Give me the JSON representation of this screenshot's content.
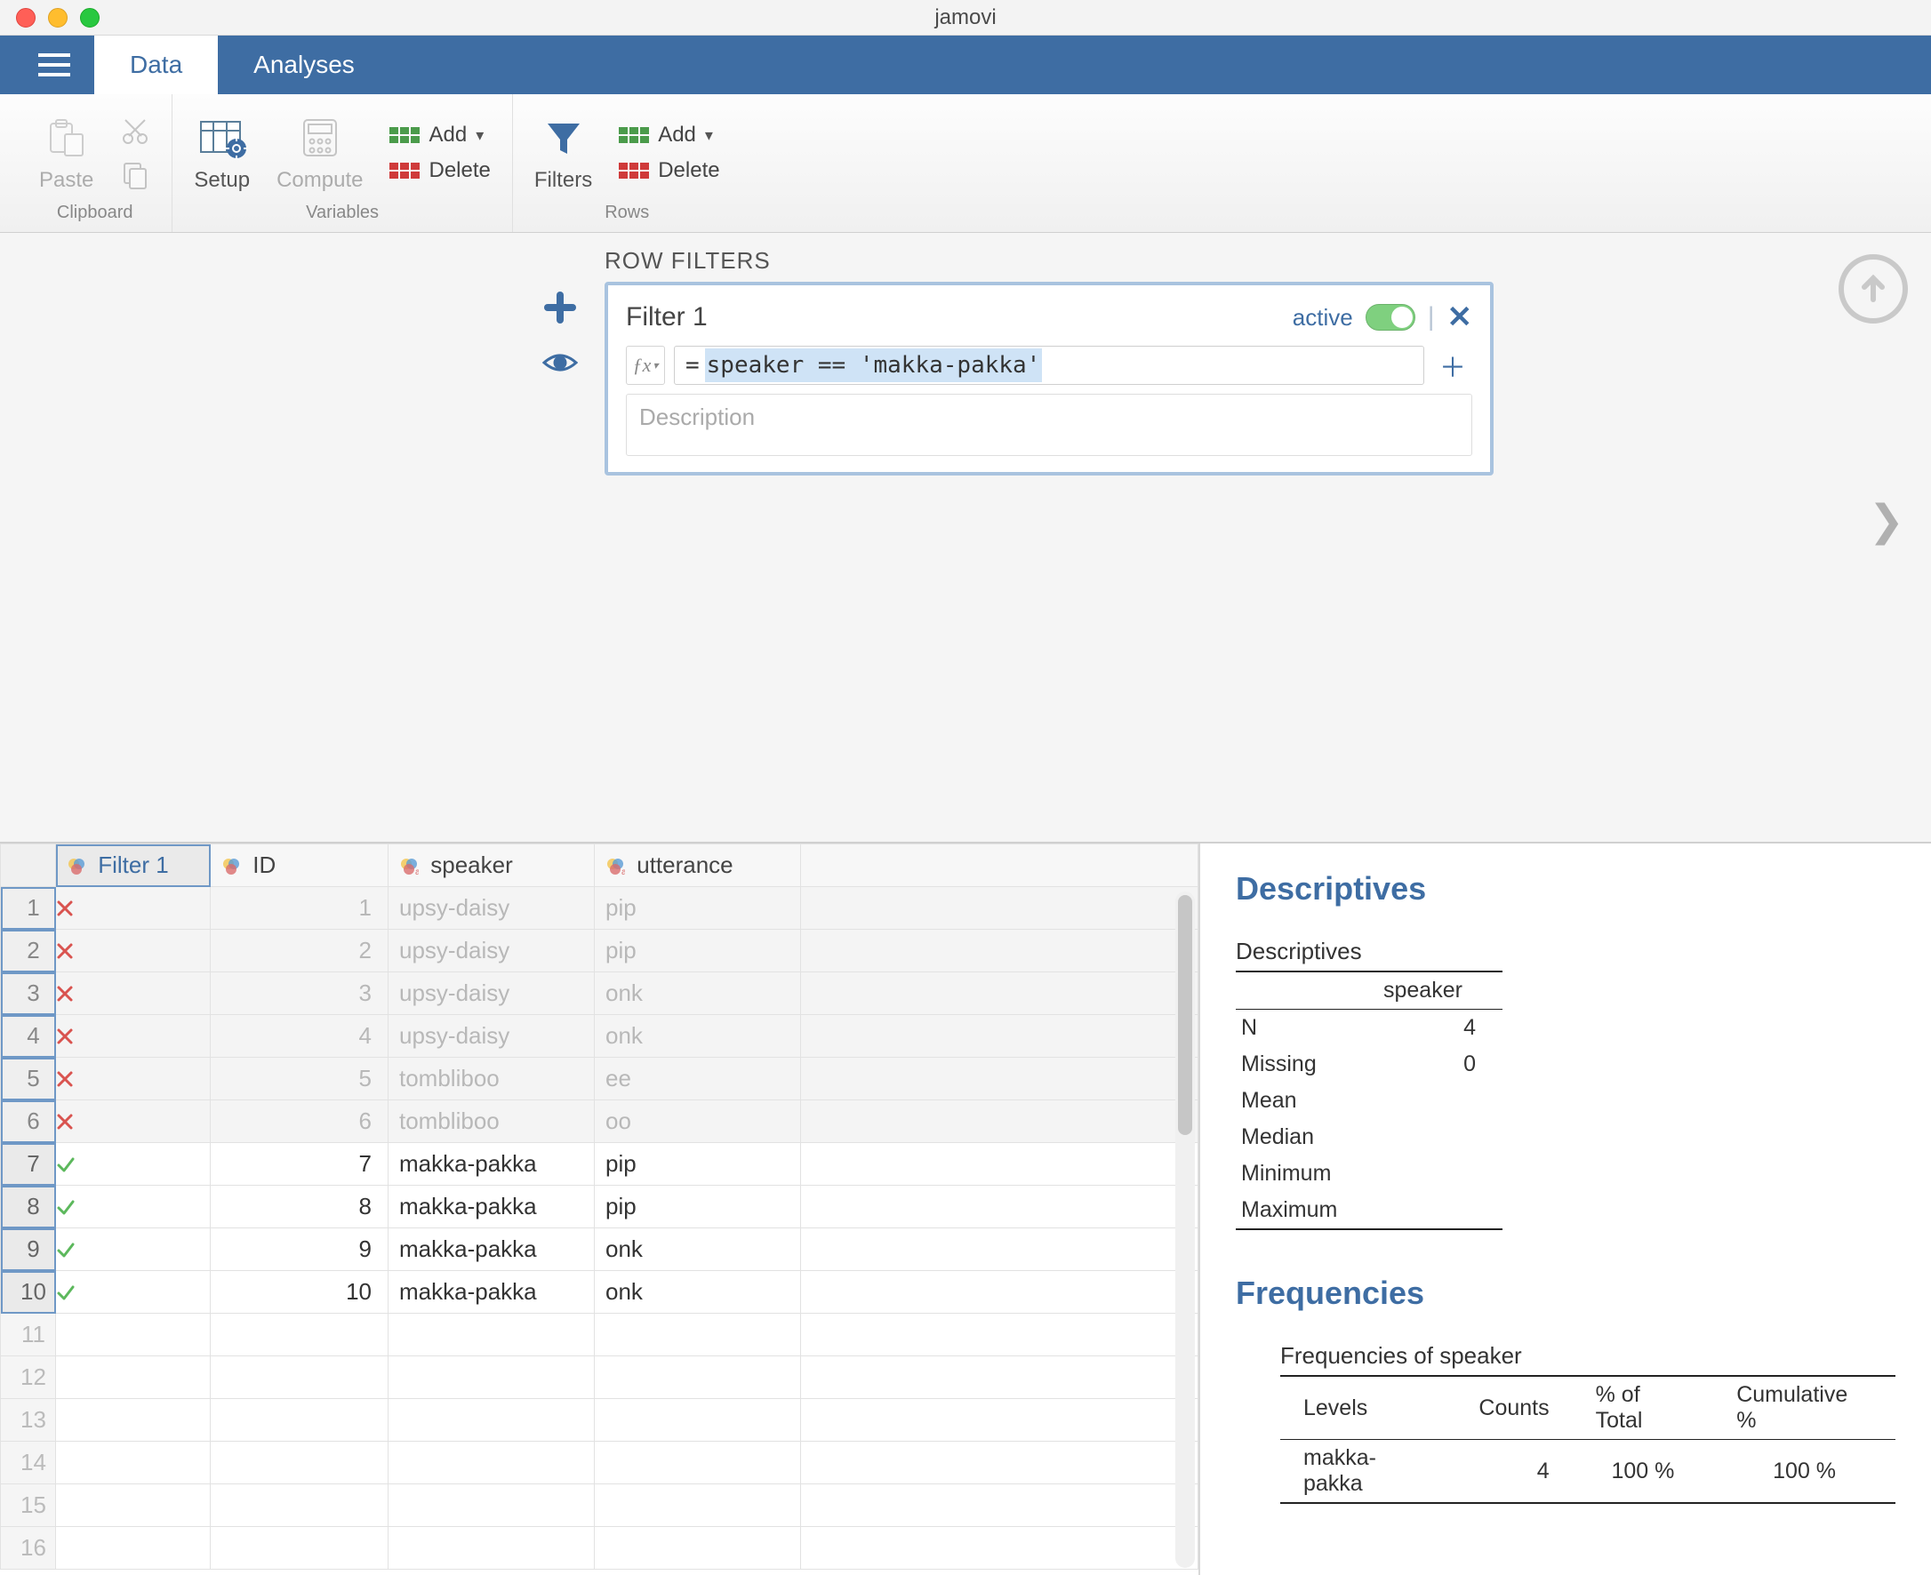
{
  "window": {
    "title": "jamovi"
  },
  "tabs": {
    "data": "Data",
    "analyses": "Analyses"
  },
  "ribbon": {
    "paste": "Paste",
    "clipboard": "Clipboard",
    "setup": "Setup",
    "compute": "Compute",
    "variables": "Variables",
    "var_add": "Add",
    "var_delete": "Delete",
    "filters": "Filters",
    "row_add": "Add",
    "row_delete": "Delete",
    "rows": "Rows"
  },
  "filter_panel": {
    "heading": "ROW FILTERS",
    "card_title": "Filter 1",
    "active_label": "active",
    "fx_label": "ƒx",
    "formula_eq": "=",
    "formula_expr": "speaker == 'makka-pakka'",
    "desc_placeholder": "Description"
  },
  "spreadsheet": {
    "columns": {
      "filter": "Filter 1",
      "id": "ID",
      "speaker": "speaker",
      "utterance": "utterance"
    },
    "rows": [
      {
        "n": 1,
        "pass": false,
        "id": 1,
        "speaker": "upsy-daisy",
        "utterance": "pip"
      },
      {
        "n": 2,
        "pass": false,
        "id": 2,
        "speaker": "upsy-daisy",
        "utterance": "pip"
      },
      {
        "n": 3,
        "pass": false,
        "id": 3,
        "speaker": "upsy-daisy",
        "utterance": "onk"
      },
      {
        "n": 4,
        "pass": false,
        "id": 4,
        "speaker": "upsy-daisy",
        "utterance": "onk"
      },
      {
        "n": 5,
        "pass": false,
        "id": 5,
        "speaker": "tombliboo",
        "utterance": "ee"
      },
      {
        "n": 6,
        "pass": false,
        "id": 6,
        "speaker": "tombliboo",
        "utterance": "oo"
      },
      {
        "n": 7,
        "pass": true,
        "id": 7,
        "speaker": "makka-pakka",
        "utterance": "pip"
      },
      {
        "n": 8,
        "pass": true,
        "id": 8,
        "speaker": "makka-pakka",
        "utterance": "pip"
      },
      {
        "n": 9,
        "pass": true,
        "id": 9,
        "speaker": "makka-pakka",
        "utterance": "onk"
      },
      {
        "n": 10,
        "pass": true,
        "id": 10,
        "speaker": "makka-pakka",
        "utterance": "onk"
      }
    ],
    "empty_rows": [
      11,
      12,
      13,
      14,
      15,
      16
    ]
  },
  "results": {
    "descriptives_title": "Descriptives",
    "descriptives_sub": "Descriptives",
    "desc_col": "speaker",
    "desc_rows": [
      {
        "label": "N",
        "value": "4"
      },
      {
        "label": "Missing",
        "value": "0"
      },
      {
        "label": "Mean",
        "value": ""
      },
      {
        "label": "Median",
        "value": ""
      },
      {
        "label": "Minimum",
        "value": ""
      },
      {
        "label": "Maximum",
        "value": ""
      }
    ],
    "frequencies_title": "Frequencies",
    "freq_sub": "Frequencies of speaker",
    "freq_headers": {
      "levels": "Levels",
      "counts": "Counts",
      "pct": "% of Total",
      "cum": "Cumulative %"
    },
    "freq_rows": [
      {
        "level": "makka-pakka",
        "counts": "4",
        "pct": "100 %",
        "cum": "100 %"
      }
    ]
  }
}
